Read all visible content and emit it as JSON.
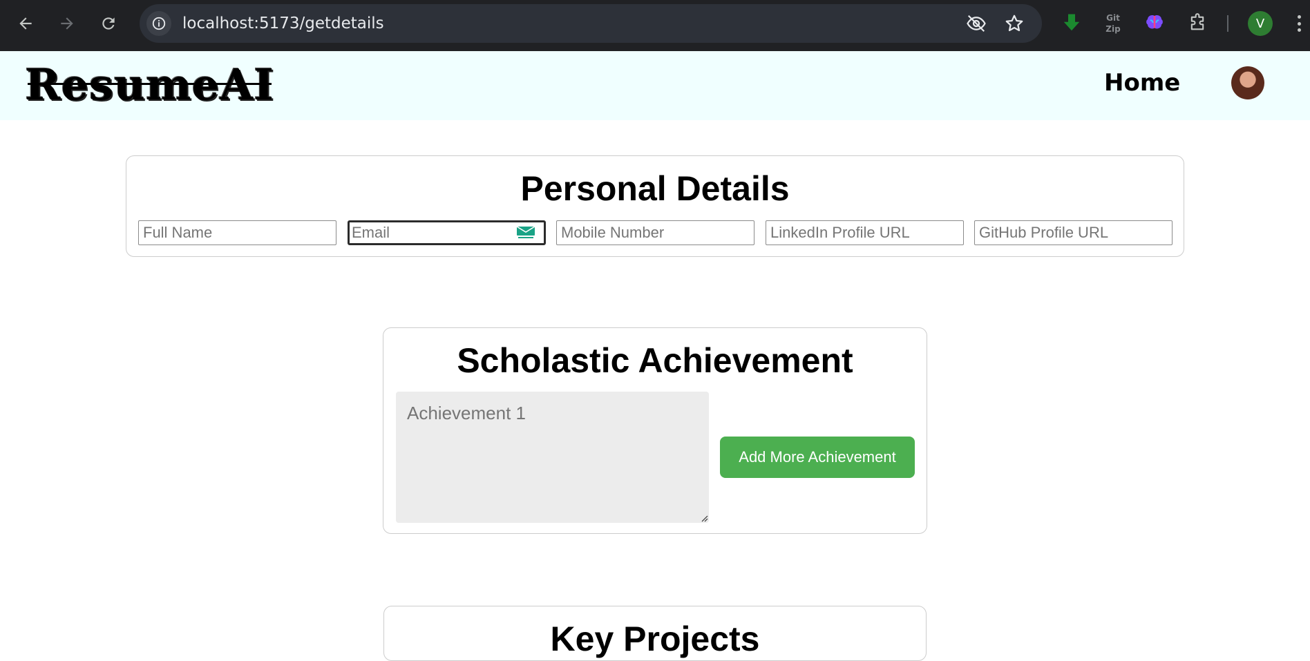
{
  "browser": {
    "url": "localhost:5173/getdetails",
    "profile_initial": "V"
  },
  "header": {
    "logo": "ResumeAI",
    "nav_home": "Home"
  },
  "personal_details": {
    "title": "Personal Details",
    "fields": {
      "full_name": "Full Name",
      "email": "Email",
      "mobile": "Mobile Number",
      "linkedin": "LinkedIn Profile URL",
      "github": "GitHub Profile URL"
    }
  },
  "scholastic": {
    "title": "Scholastic Achievement",
    "achievement_placeholder": "Achievement 1",
    "add_button": "Add More Achievement"
  },
  "projects": {
    "title": "Key Projects"
  },
  "colors": {
    "header_bg": "#f0ffff",
    "button_green": "#4caf50",
    "chrome_bg": "#202124"
  },
  "icons": [
    "back-arrow-icon",
    "forward-arrow-icon",
    "reload-icon",
    "site-info-icon",
    "eye-off-icon",
    "star-icon",
    "download-extension-icon",
    "gitzip-icon",
    "brain-extension-icon",
    "puzzle-extensions-icon",
    "more-menu-icon",
    "tempmail-icon"
  ]
}
